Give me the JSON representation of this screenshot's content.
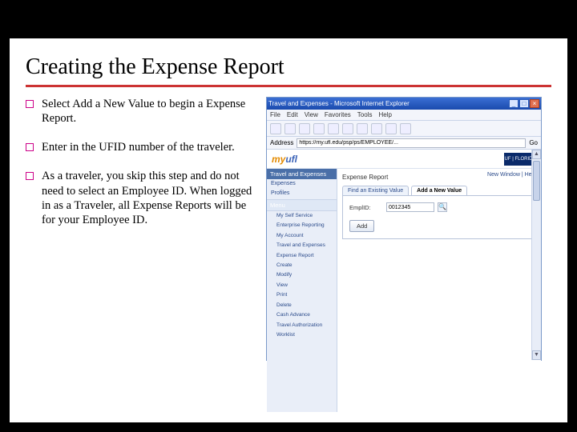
{
  "title": "Creating the Expense Report",
  "bullets": [
    "Select Add a New Value to begin a Expense Report.",
    "Enter in the UFID number of the traveler.",
    "As a traveler, you skip this step and do not need to select an Employee ID.  When logged in as a Traveler, all Expense Reports will be for your Employee ID."
  ],
  "browser": {
    "window_title": "Travel and Expenses - Microsoft Internet Explorer",
    "menu": [
      "File",
      "Edit",
      "View",
      "Favorites",
      "Tools",
      "Help"
    ],
    "address_label": "Address",
    "address_value": "https://my.ufl.edu/psp/ps/EMPLOYEE/...",
    "go_label": "Go"
  },
  "portal": {
    "logo_my": "my",
    "logo_ufl": "ufl",
    "uf_badge": "UF | FLORIDA",
    "nav_header": "Travel and Expenses",
    "nav_items": [
      "Expenses",
      "Profiles"
    ],
    "menu_header": "Menu",
    "menu_items": [
      "My Self Service",
      "Enterprise Reporting",
      "My Account",
      "Travel and Expenses",
      "  Expense Report",
      "    Create",
      "    Modify",
      "    View",
      "    Print",
      "    Delete",
      "  Cash Advance",
      "  Travel Authorization",
      "Worklist"
    ]
  },
  "main": {
    "heading": "Expense Report",
    "right_links": "New Window | Help",
    "tab_find": "Find an Existing Value",
    "tab_add": "Add a New Value",
    "field_label": "EmplID:",
    "field_value": "0012345",
    "button_add": "Add"
  }
}
